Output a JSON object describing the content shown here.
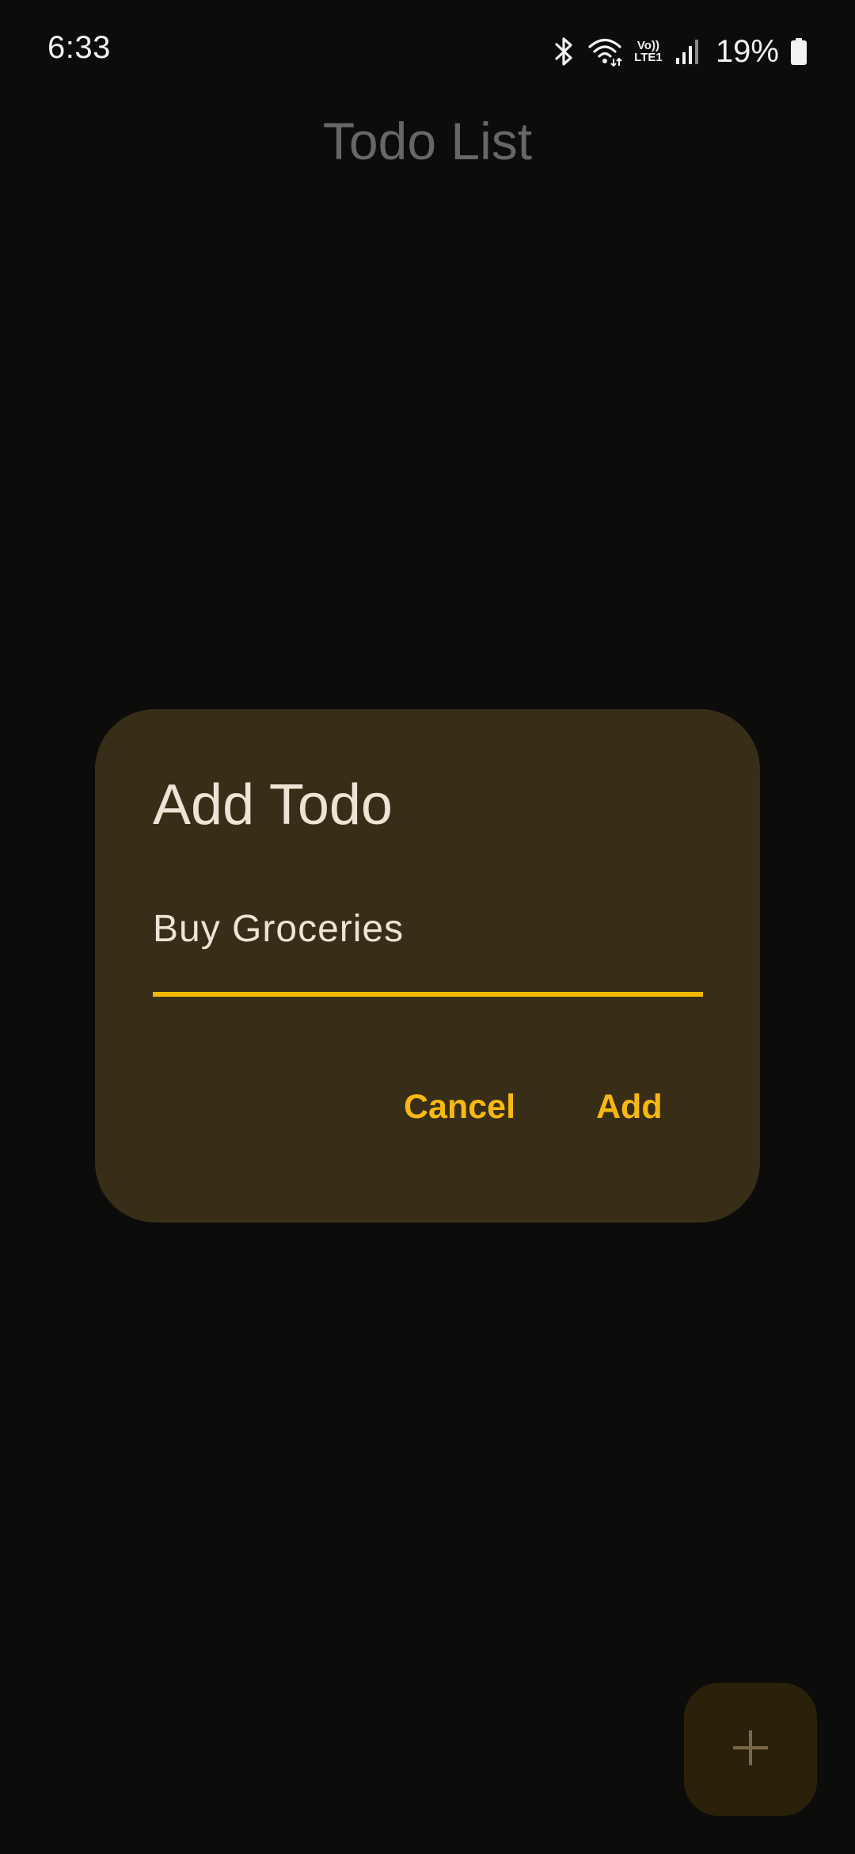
{
  "status_bar": {
    "time": "6:33",
    "volte_line1": "Vo))",
    "volte_line2": "LTE1",
    "battery": "19%",
    "icons": [
      "bluetooth-icon",
      "wifi-icon",
      "volte-icon",
      "signal-icon",
      "battery-icon"
    ]
  },
  "app_bar": {
    "title": "Todo List"
  },
  "dialog": {
    "title": "Add Todo",
    "input_value": "Buy Groceries",
    "cancel_label": "Cancel",
    "add_label": "Add"
  },
  "fab": {
    "icon": "plus-icon"
  },
  "colors": {
    "background": "#0c0c0b",
    "dialog_surface": "#382e18",
    "accent": "#f5b800",
    "dialog_text": "#efe3d6",
    "dimmed_title": "#676767",
    "fab_background": "#2b210b"
  }
}
